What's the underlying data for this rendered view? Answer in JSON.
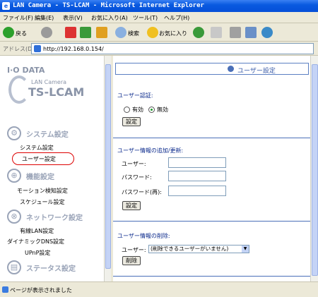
{
  "window": {
    "title": "LAN Camera - TS-LCAM - Microsoft Internet Explorer"
  },
  "menu": [
    "ファイル(F)",
    "編集(E)",
    "表示(V)",
    "お気に入り(A)",
    "ツール(T)",
    "ヘルプ(H)"
  ],
  "toolbar": {
    "back_label": "戻る",
    "search_label": "検索",
    "favorites_label": "お気に入り"
  },
  "address": {
    "label": "アドレス(D)",
    "url": "http://192.168.0.154/"
  },
  "sidebar": {
    "brand": "I·O DATA",
    "product_sub": "LAN Camera",
    "product": "TS-LCAM",
    "sections": [
      {
        "title": "システム設定",
        "items": [
          "システム設定",
          "ユーザー設定"
        ]
      },
      {
        "title": "機能設定",
        "items": [
          "モーション検知設定",
          "スケジュール設定"
        ]
      },
      {
        "title": "ネットワーク設定",
        "items": [
          "有線LAN設定",
          "ダイナミックDNS設定",
          "UPnP設定"
        ]
      },
      {
        "title": "ステータス設定",
        "items": []
      }
    ],
    "highlighted_item": "ユーザー設定"
  },
  "main": {
    "header": "ユーザー設定",
    "auth": {
      "heading": "ユーザー認証:",
      "options": [
        "有効",
        "無効"
      ],
      "selected": "無効",
      "button": "設定"
    },
    "add": {
      "heading": "ユーザー情報の追加/更新:",
      "user_label": "ユーザー:",
      "user_value": "",
      "pass_label": "パスワード:",
      "pass_value": "",
      "repass_label": "パスワード(再):",
      "repass_value": "",
      "button": "設定"
    },
    "delete": {
      "heading": "ユーザー情報の削除:",
      "user_label": "ユーザー:",
      "select_value": "(削除できるユーザーがいません)",
      "button": "削除"
    }
  },
  "status": {
    "text": "ページが表示されました"
  }
}
